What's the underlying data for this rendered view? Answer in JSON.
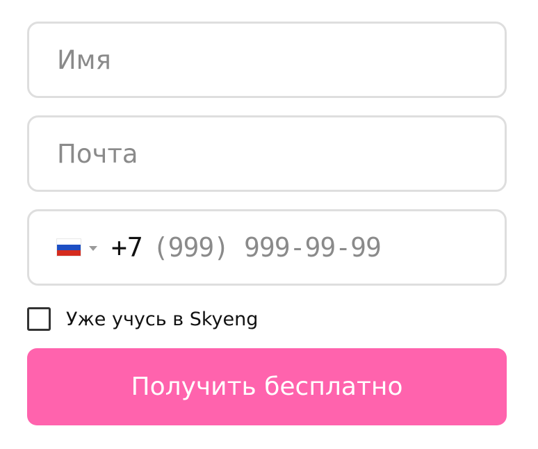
{
  "form": {
    "name_field": {
      "value": "",
      "placeholder": "Имя"
    },
    "email_field": {
      "value": "",
      "placeholder": "Почта"
    },
    "phone_field": {
      "country_flag": "russia-flag-icon",
      "country_code": "+7",
      "value": "",
      "placeholder": "(999) 999-99-99"
    },
    "already_student": {
      "checked": false,
      "label": "Уже учусь в Skyeng"
    },
    "submit_label": "Получить бесплатно"
  },
  "colors": {
    "accent": "#ff63ad",
    "field_border": "#dedede",
    "placeholder": "#8a8a8a"
  }
}
